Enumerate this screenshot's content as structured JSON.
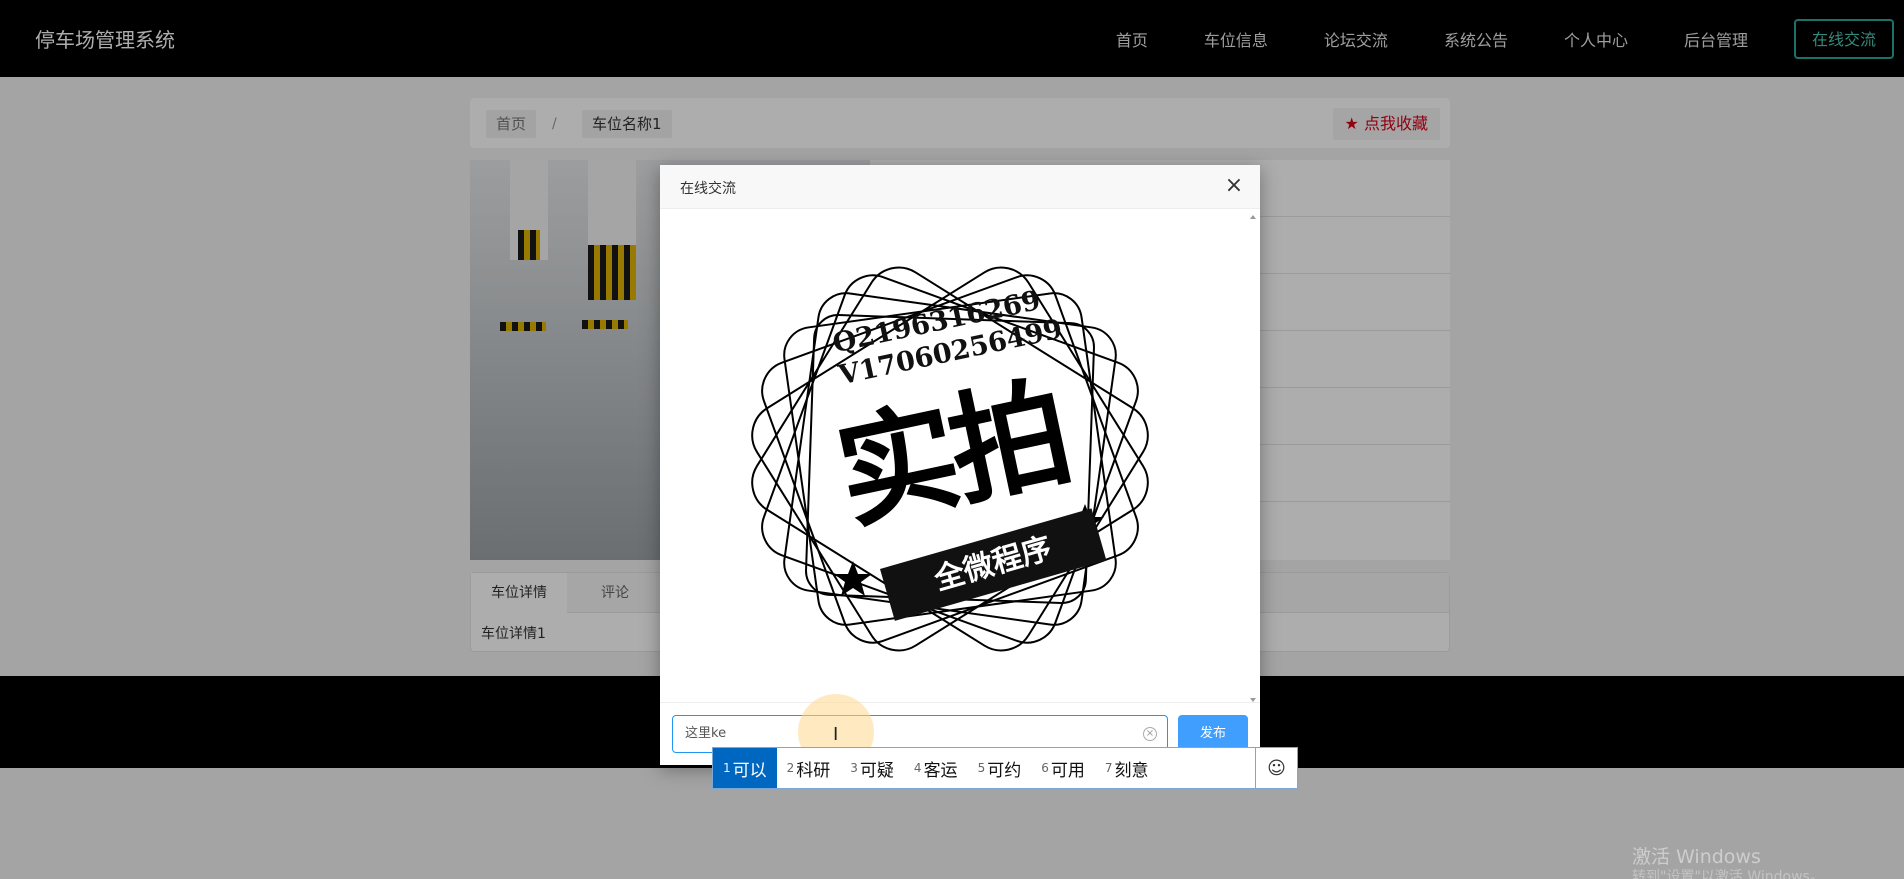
{
  "header": {
    "brand": "停车场管理系统",
    "nav": [
      "首页",
      "车位信息",
      "论坛交流",
      "系统公告",
      "个人中心",
      "后台管理"
    ],
    "nav_button": "在线交流"
  },
  "breadcrumb": {
    "home": "首页",
    "separator": "/",
    "current": "车位名称1"
  },
  "favorite_button": "点我收藏",
  "tabs": {
    "items": [
      "车位详情",
      "评论"
    ],
    "active_content": "车位详情1"
  },
  "dialog": {
    "title": "在线交流",
    "close": "×",
    "image_text": {
      "qq": "Q2196316269",
      "wechat": "V17060256499",
      "big": "实拍",
      "ribbon": "全微程序"
    },
    "input_value": "这里ke",
    "send_button": "发布"
  },
  "ime": {
    "candidates": [
      {
        "index": "1",
        "text": "可以",
        "active": true
      },
      {
        "index": "2",
        "text": "科研"
      },
      {
        "index": "3",
        "text": "可疑"
      },
      {
        "index": "4",
        "text": "客运"
      },
      {
        "index": "5",
        "text": "可约"
      },
      {
        "index": "6",
        "text": "可用"
      },
      {
        "index": "7",
        "text": "刻意"
      }
    ],
    "emoji_icon": "☺"
  },
  "watermark": {
    "line1": "激活 Windows",
    "line2": "转到\"设置\"以激活 Windows。"
  },
  "colors": {
    "header_bg": "#000000",
    "accent": "#4ec9b8",
    "send_button": "#409eff",
    "ime_active": "#0067c0",
    "favorite": "#d9001b"
  }
}
